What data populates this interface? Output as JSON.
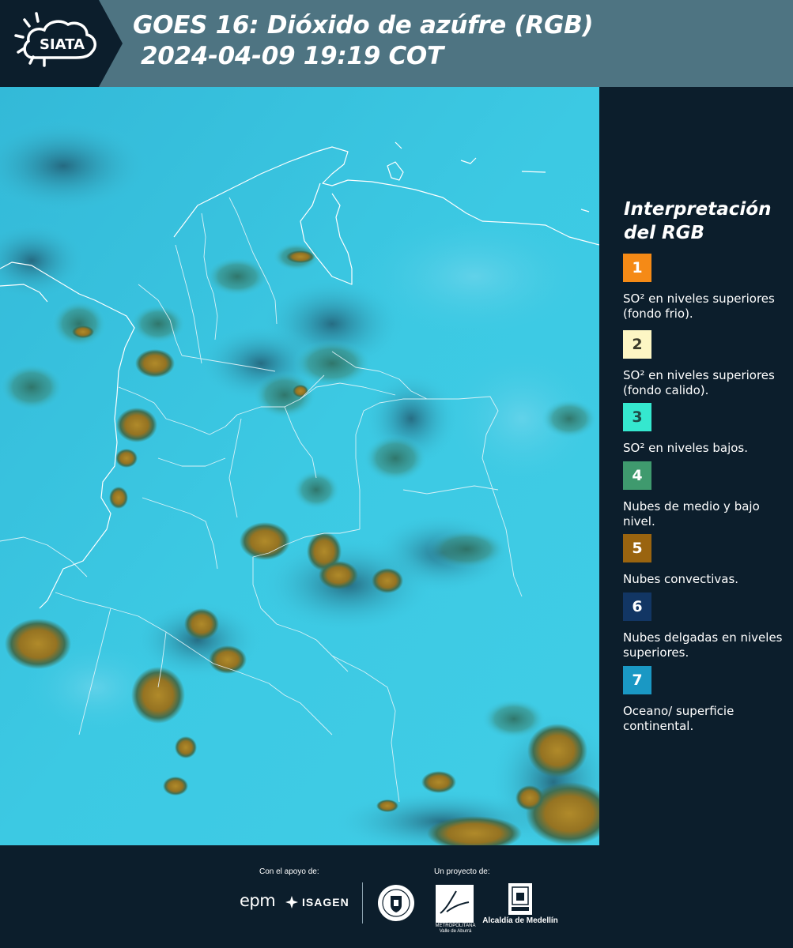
{
  "header": {
    "logo_text": "SIATA",
    "title_line1": "GOES 16: Dióxido de azúfre (RGB)",
    "title_line2": "2024-04-09 19:19 COT"
  },
  "legend": {
    "title": "Interpretación del RGB",
    "items": [
      {
        "number": "1",
        "color": "#f58a16",
        "text_color": "#ffffff",
        "text": "SO² en niveles superiores (fondo frio)."
      },
      {
        "number": "2",
        "color": "#fdf6c4",
        "text_color": "#3a3a2a",
        "text": "SO² en niveles superiores (fondo calido)."
      },
      {
        "number": "3",
        "color": "#35e8cf",
        "text_color": "#1d4b46",
        "text": "SO² en niveles bajos."
      },
      {
        "number": "4",
        "color": "#3f9a6e",
        "text_color": "#ffffff",
        "text": "Nubes de medio y bajo nivel."
      },
      {
        "number": "5",
        "color": "#9a640f",
        "text_color": "#ffffff",
        "text": "Nubes convectivas."
      },
      {
        "number": "6",
        "color": "#123664",
        "text_color": "#ffffff",
        "text": "Nubes delgadas en niveles superiores."
      },
      {
        "number": "7",
        "color": "#1a98c4",
        "text_color": "#ffffff",
        "text": "Oceano/ superficie continental."
      }
    ]
  },
  "footer": {
    "support_label": "Con el apoyo de:",
    "project_label": "Un proyecto de:",
    "sponsor_epm": "epm",
    "sponsor_isagen": "ISAGEN",
    "area_name": "METROPOLITANA Valle de Aburrá",
    "alcaldia_name": "Alcaldía de Medellín"
  },
  "colors": {
    "header_bg": "#4e7482",
    "logo_bg": "#0c1e2c",
    "panel_bg": "#0c1e2c",
    "surface": "#3cc9e3",
    "cloud_convective": "#a07a20",
    "cloud_low": "#3f8a72"
  }
}
